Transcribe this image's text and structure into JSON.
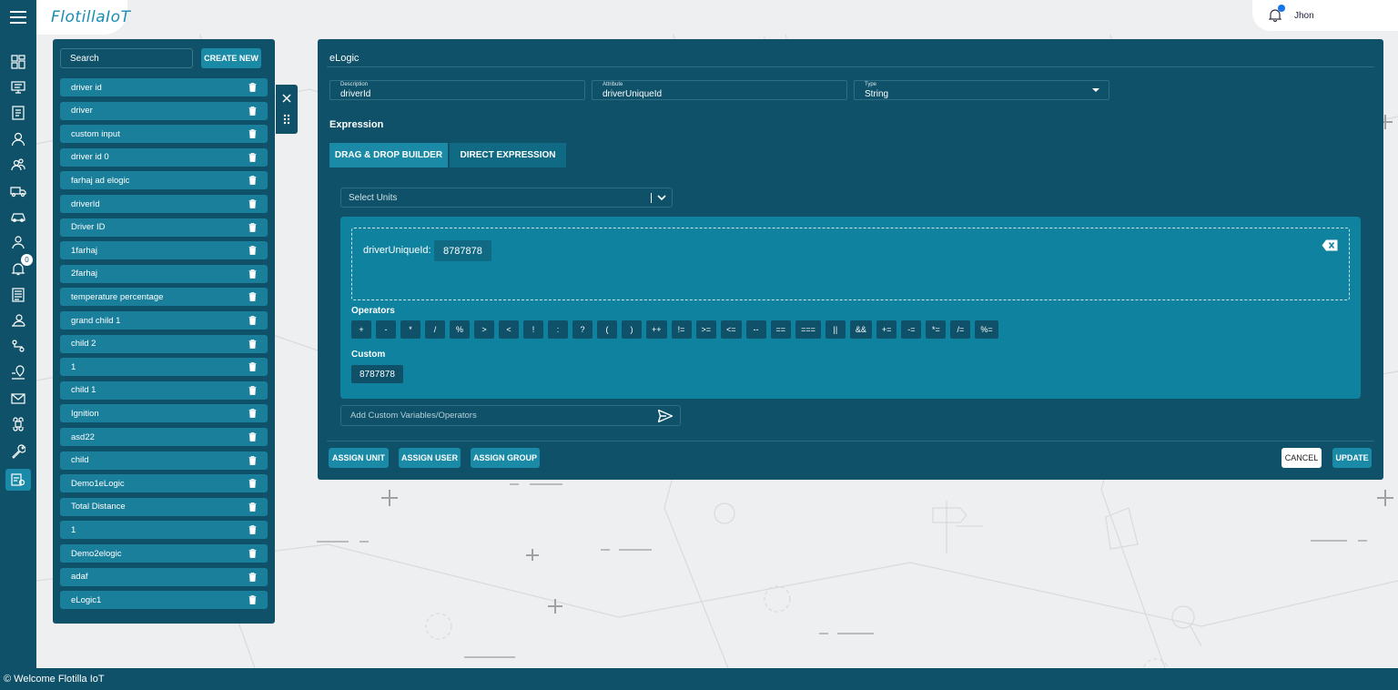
{
  "header": {
    "logo": "FlotillaIoT",
    "user_name": "Jhon"
  },
  "sidebar": {
    "icons": [
      "dashboard-icon",
      "monitor-icon",
      "checklist-icon",
      "user-icon",
      "group-icon",
      "truck-icon",
      "car-icon",
      "person-pin-icon",
      "bell-icon",
      "document-icon",
      "user-card-icon",
      "route-icon",
      "map-pin-icon",
      "mail-icon",
      "command-icon",
      "wrench-icon",
      "elogic-icon"
    ],
    "notification_count": "0"
  },
  "list_panel": {
    "search_label": "Search",
    "create_label": "CREATE NEW",
    "items": [
      "driver id",
      "driver",
      "custom input",
      "driver id 0",
      "farhaj ad elogic",
      "driverId",
      "Driver ID",
      "1farhaj",
      "2farhaj",
      "temperature percentage",
      "grand child 1",
      "child 2",
      "1",
      "child 1",
      "Ignition",
      "asd22",
      "child",
      "Demo1eLogic",
      "Total Distance",
      "1",
      "Demo2elogic",
      "adaf",
      "eLogic1"
    ]
  },
  "main": {
    "title": "eLogic",
    "description": {
      "label": "Description",
      "value": "driverId"
    },
    "attribute": {
      "label": "Attribute",
      "value": "driverUniqueId"
    },
    "type": {
      "label": "Type",
      "value": "String"
    },
    "expression_label": "Expression",
    "tabs": [
      "DRAG & DROP BUILDER",
      "DIRECT EXPRESSION"
    ],
    "units_placeholder": "Select Units",
    "expression": {
      "label": "driverUniqueId:",
      "chip": "8787878"
    },
    "operators_label": "Operators",
    "operators": [
      "+",
      "-",
      "*",
      "/",
      "%",
      ">",
      "<",
      "!",
      ":",
      "?",
      "(",
      ")",
      "++",
      "!=",
      ">=",
      "<=",
      "--",
      "==",
      "===",
      "||",
      "&&",
      "+=",
      "-=",
      "*=",
      "/=",
      "%="
    ],
    "custom_label": "Custom",
    "custom_chip": "8787878",
    "add_custom_placeholder": "Add Custom Variables/Operators",
    "buttons": {
      "assign_unit": "ASSIGN UNIT",
      "assign_user": "ASSIGN USER",
      "assign_group": "ASSIGN GROUP",
      "cancel": "CANCEL",
      "update": "UPDATE"
    }
  },
  "footer": {
    "text": "© Welcome Flotilla IoT"
  }
}
